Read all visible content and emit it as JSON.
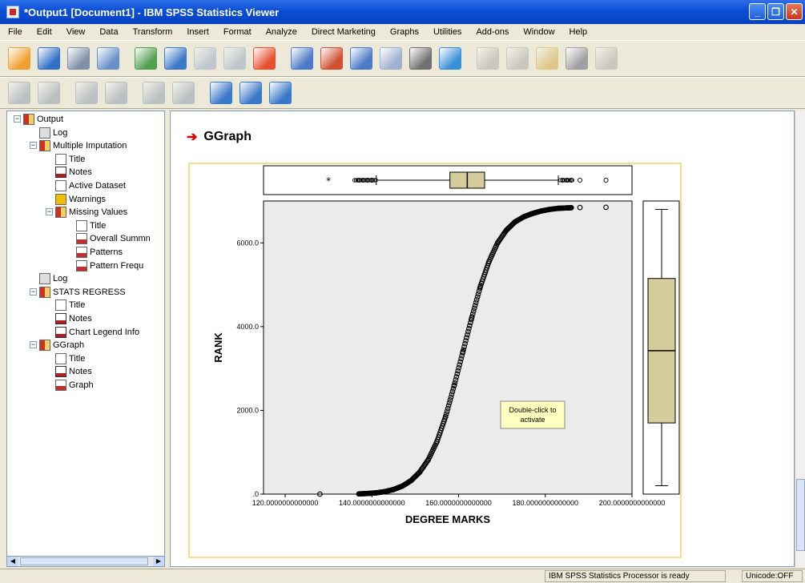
{
  "window": {
    "title": "*Output1 [Document1] - IBM SPSS Statistics Viewer"
  },
  "menu": [
    "File",
    "Edit",
    "View",
    "Data",
    "Transform",
    "Insert",
    "Format",
    "Analyze",
    "Direct Marketing",
    "Graphs",
    "Utilities",
    "Add-ons",
    "Window",
    "Help"
  ],
  "toolbar1_icons": [
    "open-icon",
    "save-icon",
    "print-icon",
    "print-preview-icon",
    "export-icon",
    "recall-dialog-icon",
    "undo-icon",
    "redo-icon",
    "goto-data-icon",
    "goto-case-icon",
    "goto-variable-icon",
    "variables-icon",
    "run-descriptives-icon",
    "use-variable-sets-icon",
    "show-all-variables-icon",
    "spelling-icon",
    "designate-window-icon",
    "select-last-output-icon",
    "create-edit-autoscript-icon",
    "run-script-icon"
  ],
  "toolbar2_icons": [
    "promote-icon",
    "demote-icon",
    "expand-icon",
    "collapse-icon",
    "show-icon",
    "hide-icon",
    "insert-heading-icon",
    "insert-title-icon",
    "insert-text-icon"
  ],
  "outline": [
    {
      "label": "Output",
      "icon": "book",
      "level": 0
    },
    {
      "label": "Log",
      "icon": "log",
      "level": 1
    },
    {
      "label": "Multiple Imputation",
      "icon": "book",
      "level": 1
    },
    {
      "label": "Title",
      "icon": "page",
      "level": 2
    },
    {
      "label": "Notes",
      "icon": "notes",
      "level": 2
    },
    {
      "label": "Active Dataset",
      "icon": "page",
      "level": 2
    },
    {
      "label": "Warnings",
      "icon": "warn",
      "level": 2
    },
    {
      "label": "Missing Values",
      "icon": "book",
      "level": 2
    },
    {
      "label": "Title",
      "icon": "page",
      "level": 3
    },
    {
      "label": "Overall Summn",
      "icon": "chart",
      "level": 3
    },
    {
      "label": "Patterns",
      "icon": "chart",
      "level": 3
    },
    {
      "label": "Pattern Frequ",
      "icon": "chart",
      "level": 3
    },
    {
      "label": "Log",
      "icon": "log",
      "level": 1
    },
    {
      "label": "STATS REGRESS",
      "icon": "book",
      "level": 1
    },
    {
      "label": "Title",
      "icon": "page",
      "level": 2
    },
    {
      "label": "Notes",
      "icon": "notes",
      "level": 2
    },
    {
      "label": "Chart Legend Info",
      "icon": "notes",
      "level": 2
    },
    {
      "label": "GGraph",
      "icon": "book",
      "level": 1
    },
    {
      "label": "Title",
      "icon": "page",
      "level": 2
    },
    {
      "label": "Notes",
      "icon": "notes",
      "level": 2
    },
    {
      "label": "Graph",
      "icon": "chart",
      "level": 2
    }
  ],
  "output": {
    "heading": "GGraph",
    "tooltip": "Double-click to activate"
  },
  "chart_data": {
    "type": "scatter",
    "xlabel": "DEGREE MARKS",
    "ylabel": "RANK",
    "x_ticks": [
      "120.0000000000000",
      "140.0000000000000",
      "160.0000000000000",
      "180.0000000000000",
      "200.0000000000000"
    ],
    "y_ticks": [
      ".0",
      "2000.0",
      "4000.0",
      "6000.0"
    ],
    "xlim": [
      115,
      200
    ],
    "ylim": [
      0,
      7000
    ],
    "grid": false,
    "background": "#ebebeb",
    "box_fill": "#d4cc9a",
    "series_description": "cumulative rank vs marks (sigmoid), dense points",
    "series": [
      {
        "x": [
          128,
          137,
          139,
          141,
          143,
          145,
          147,
          149,
          151,
          153,
          155,
          157,
          159,
          161,
          163,
          165,
          167,
          169,
          171,
          173,
          175,
          177,
          179,
          181,
          183,
          185,
          186,
          188,
          194
        ],
        "y": [
          0,
          5,
          15,
          30,
          60,
          110,
          190,
          320,
          520,
          820,
          1250,
          1850,
          2600,
          3400,
          4200,
          4950,
          5550,
          6000,
          6300,
          6500,
          6620,
          6700,
          6760,
          6800,
          6825,
          6835,
          6840,
          6845,
          6850
        ]
      }
    ],
    "x_boxplot": {
      "min": 141,
      "q1": 158,
      "median": 162,
      "q3": 166,
      "max": 183,
      "outliers": [
        130,
        137,
        138,
        139,
        140,
        184,
        185,
        186,
        188,
        194
      ]
    },
    "y_boxplot": {
      "min": 200,
      "q1": 1700,
      "median": 3425,
      "q3": 5150,
      "max": 6800
    }
  },
  "status": {
    "processor": "IBM SPSS Statistics Processor is ready",
    "unicode": "Unicode:OFF"
  }
}
